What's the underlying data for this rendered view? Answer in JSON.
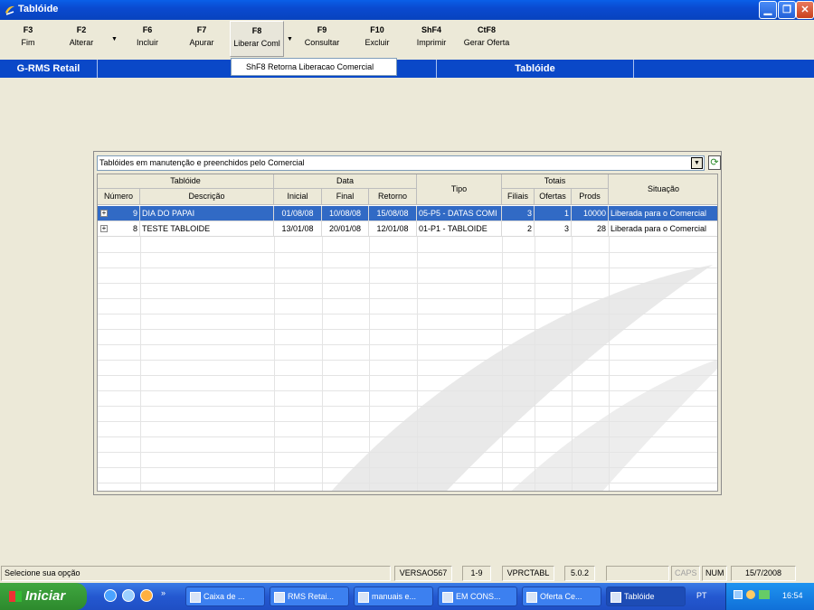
{
  "window": {
    "title": "Tablóide"
  },
  "toolbar": {
    "buttons": [
      {
        "key": "F3",
        "label": "Fim"
      },
      {
        "key": "F2",
        "label": "Alterar"
      },
      {
        "key": "F6",
        "label": "Incluir"
      },
      {
        "key": "F7",
        "label": "Apurar"
      },
      {
        "key": "F8",
        "label": "Liberar Coml"
      },
      {
        "key": "F9",
        "label": "Consultar"
      },
      {
        "key": "F10",
        "label": "Excluir"
      },
      {
        "key": "ShF4",
        "label": "Imprimir"
      },
      {
        "key": "CtF8",
        "label": "Gerar Oferta"
      }
    ],
    "dropdown_item": "ShF8  Retorna Liberacao Comercial"
  },
  "header": {
    "left": "G-RMS Retail",
    "right": "Tablóide"
  },
  "filter": {
    "value": "Tablóides em manutenção e preenchidos pelo Comercial"
  },
  "grid": {
    "group_headers": {
      "tabloide": "Tablóide",
      "data": "Data",
      "tipo": "Tipo",
      "totais": "Totais",
      "situacao": "Situação"
    },
    "columns": [
      "Número",
      "Descrição",
      "Inicial",
      "Final",
      "Retorno",
      "Filiais",
      "Ofertas",
      "Prods"
    ],
    "rows": [
      {
        "numero": "9",
        "descricao": "DIA DO PAPAI",
        "inicial": "01/08/08",
        "final": "10/08/08",
        "retorno": "15/08/08",
        "tipo": "05-P5 - DATAS COMI",
        "filiais": "3",
        "ofertas": "1",
        "prods": "10000",
        "situacao": "Liberada para o Comercial",
        "selected": true
      },
      {
        "numero": "8",
        "descricao": "TESTE TABLOIDE",
        "inicial": "13/01/08",
        "final": "20/01/08",
        "retorno": "12/01/08",
        "tipo": "01-P1 - TABLOIDE",
        "filiais": "2",
        "ofertas": "3",
        "prods": "28",
        "situacao": "Liberada para o Comercial",
        "selected": false
      }
    ]
  },
  "statusbar": {
    "message": "Selecione sua opção",
    "version": "VERSAO567",
    "range": "1-9",
    "program": "VPRCTABL",
    "release": "5.0.2",
    "caps": "CAPS",
    "num": "NUM",
    "date": "15/7/2008"
  },
  "taskbar": {
    "start_label": "Iniciar",
    "tasks": [
      "Caixa de ...",
      "RMS Retai...",
      "manuais e...",
      "EM CONS...",
      "Oferta Ce...",
      "Tablóide"
    ],
    "language": "PT",
    "clock": "16:54"
  }
}
